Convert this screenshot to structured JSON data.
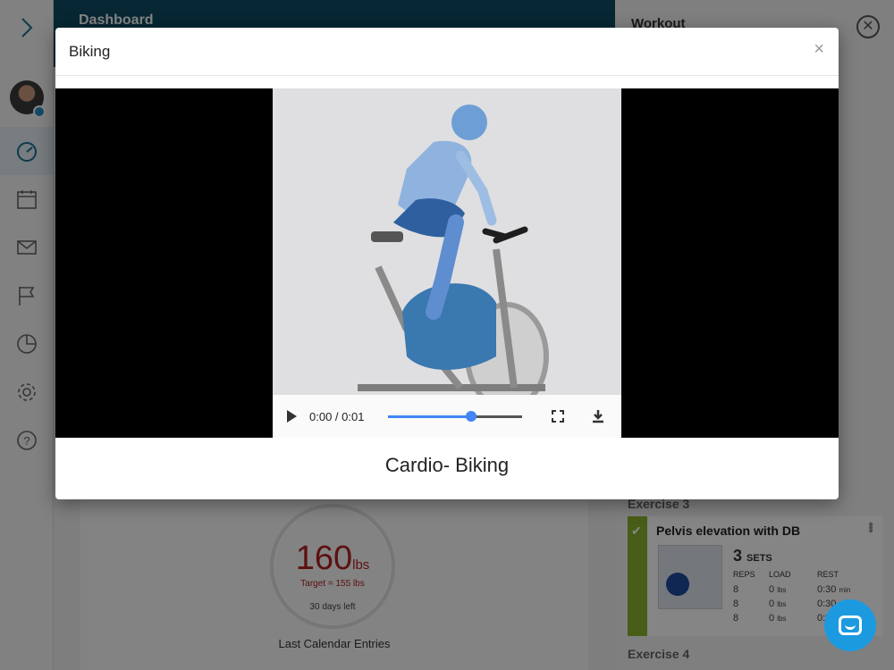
{
  "dashboard": {
    "header": "Dashboard",
    "weight_value": "160",
    "weight_unit": "lbs",
    "target_label": "Target",
    "target_value": "155 lbs",
    "days_left": "30 days left",
    "calendar_label": "Last Calendar Entries"
  },
  "workout": {
    "title": "Workout",
    "exercise3_label": "Exercise 3",
    "exercise4_label": "Exercise 4",
    "exercise": {
      "name": "Pelvis elevation with DB",
      "sets_value": "3",
      "sets_label": "SETS",
      "headers": [
        "REPS",
        "LOAD",
        "REST"
      ],
      "rows": [
        {
          "reps": "8",
          "load": "0",
          "load_unit": "lbs",
          "rest": "0:30",
          "rest_unit": "min"
        },
        {
          "reps": "8",
          "load": "0",
          "load_unit": "lbs",
          "rest": "0:30",
          "rest_unit": ""
        },
        {
          "reps": "8",
          "load": "0",
          "load_unit": "lbs",
          "rest": "0:30",
          "rest_unit": ""
        }
      ]
    }
  },
  "modal": {
    "title": "Biking",
    "close_symbol": "×",
    "caption": "Cardio- Biking",
    "video": {
      "time": "0:00 / 0:01",
      "progress": 0.62
    }
  },
  "icons": {
    "sidebar_toggle": "chevron-right-icon",
    "dashboard": "speedometer-icon",
    "calendar": "calendar-icon",
    "messages": "envelope-icon",
    "goals": "flag-icon",
    "reports": "pie-chart-icon",
    "settings": "gear-icon",
    "help": "help-icon",
    "chat": "chat-icon"
  },
  "colors": {
    "header_bg": "#0d4c63",
    "accent": "#1b9ae0",
    "weight_red": "#b22222",
    "complete_green": "#8ab22c",
    "progress_blue": "#4285f4"
  }
}
